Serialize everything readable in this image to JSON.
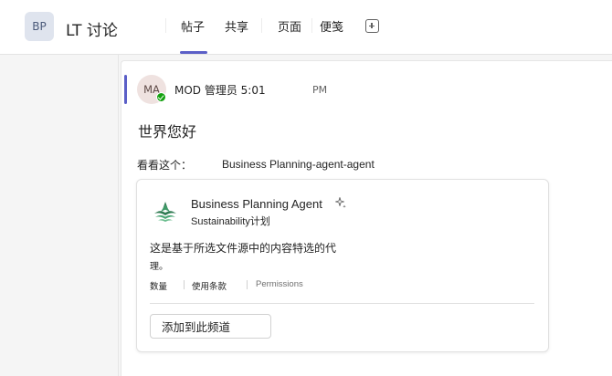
{
  "header": {
    "team_initials": "BP",
    "channel_name": "LT 讨论",
    "tabs": [
      {
        "label": "帖子",
        "active": true
      },
      {
        "label": "共享",
        "active": false
      },
      {
        "label": "页面",
        "active": false
      },
      {
        "label": "便笺",
        "active": false
      }
    ],
    "add_tab_icon": "plus-square-icon",
    "accent_color": "#5b5fc7"
  },
  "message": {
    "avatar_initials": "MA",
    "presence": "available",
    "author_and_time": "MOD 管理员 5:01",
    "ampm": "PM",
    "title": "世界您好",
    "line_prefix": "看看这个：",
    "line_link": "Business Planning-agent-agent"
  },
  "agent_card": {
    "name": "Business Planning Agent",
    "sparkle_icon": "sparkle-icon",
    "subtitle": "Sustainability计划",
    "description_line1": "这是基于所选文件源中的内容特选的代",
    "description_line2": "理。",
    "meta": [
      "数量",
      "使用条款",
      "Permissions"
    ],
    "add_button_label": "添加到此频道"
  }
}
